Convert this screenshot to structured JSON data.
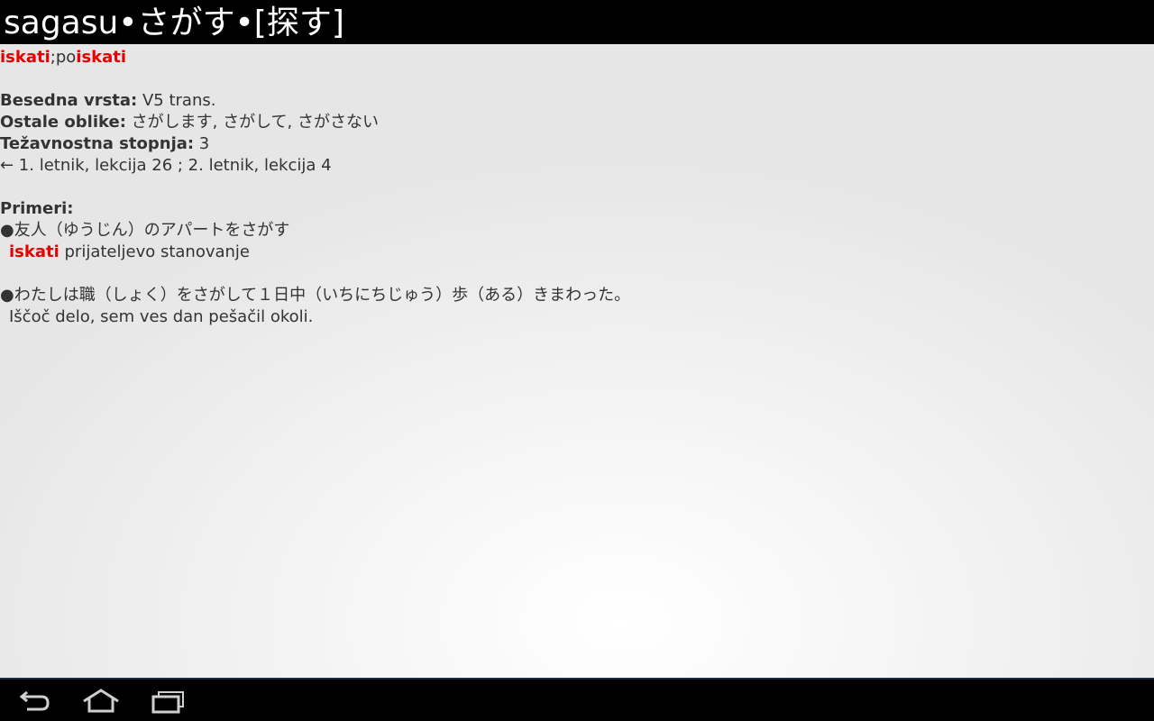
{
  "title": "sagasu•さがす•[探す]",
  "translation": {
    "first": "iskati",
    "sep": ";po",
    "second": "iskati"
  },
  "info": {
    "word_type_label": "Besedna vrsta:",
    "word_type_value": " V5 trans.",
    "other_forms_label": "Ostale oblike:",
    "other_forms_value": " さがします, さがして, さがさない",
    "difficulty_label": "Težavnostna stopnja:",
    "difficulty_value": " 3",
    "lessons": "← 1. letnik, lekcija 26 ; 2. letnik, lekcija 4"
  },
  "examples": {
    "label": "Primeri:",
    "items": [
      {
        "japanese": "●友人（ゆうじん）のアパートをさがす",
        "highlight": "iskati",
        "rest": " prijateljevo stanovanje"
      },
      {
        "japanese": "●わたしは職（しょく）をさがして１日中（いちにちじゅう）歩（ある）きまわった。",
        "translation": "Iščoč delo, sem ves dan pešačil okoli."
      }
    ]
  },
  "nav": {
    "back_icon": "back-icon",
    "home_icon": "home-icon",
    "recents_icon": "recents-icon"
  }
}
